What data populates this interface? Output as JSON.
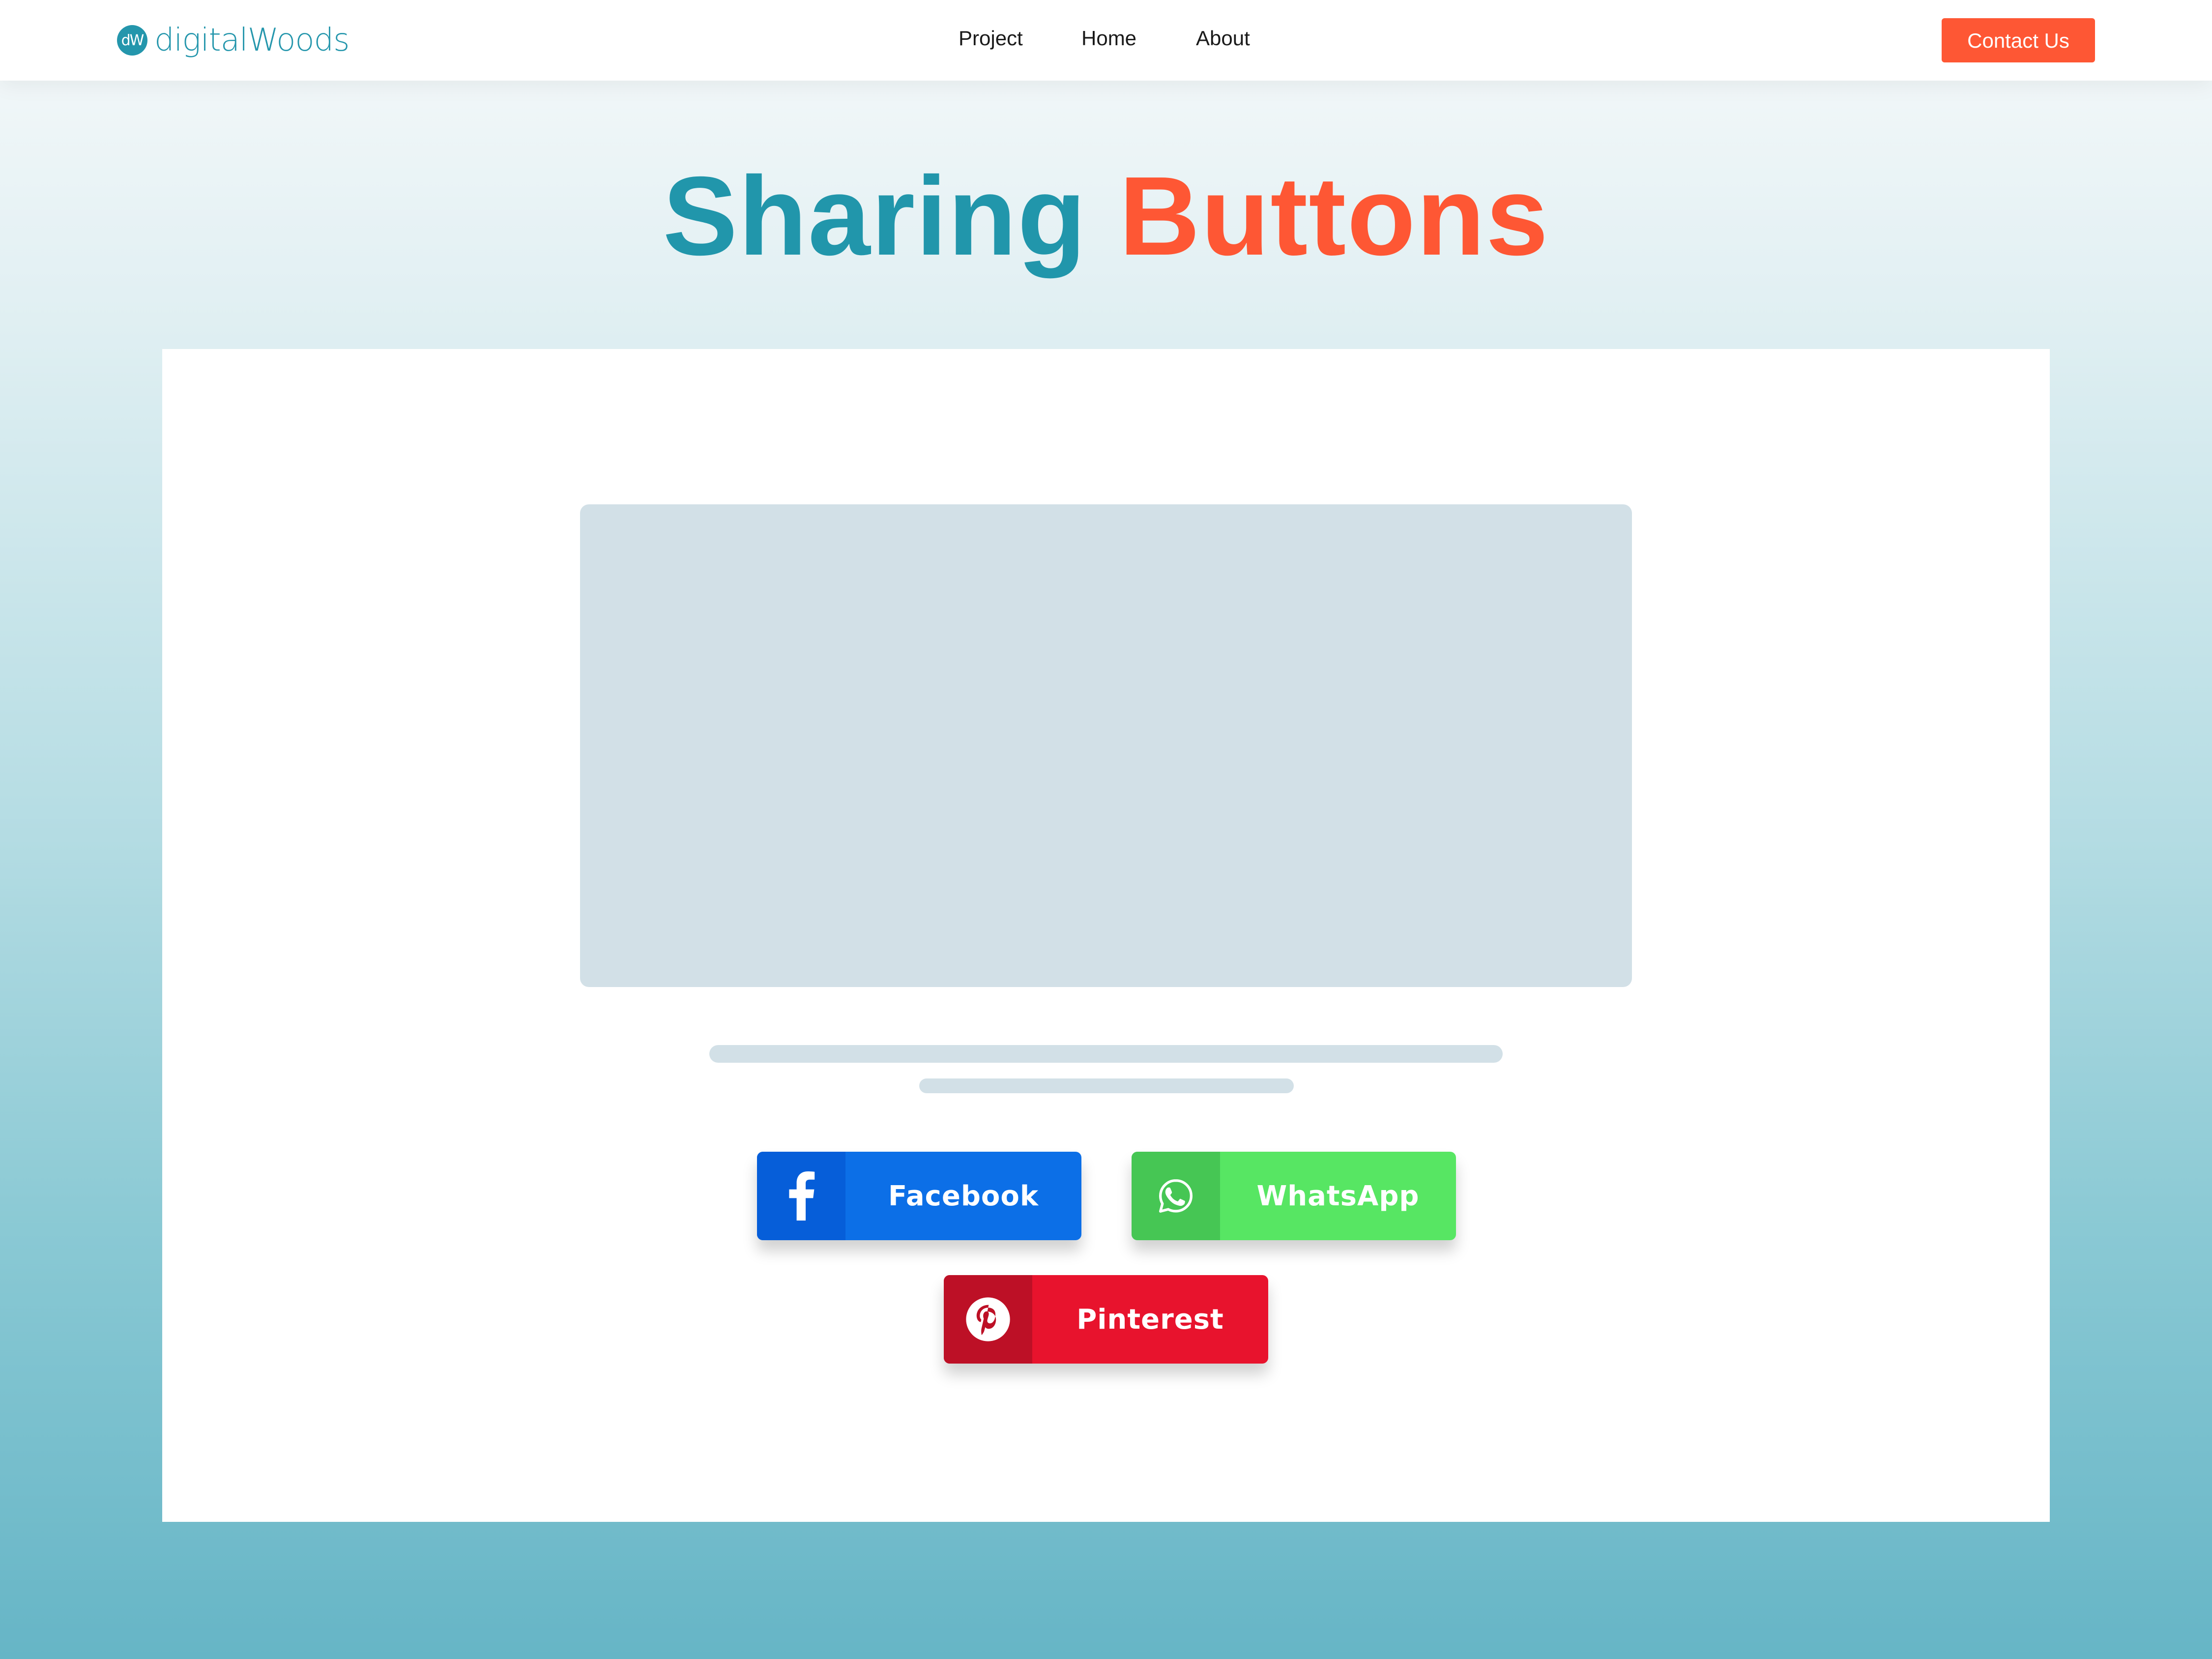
{
  "navbar": {
    "brand": {
      "icon_text": "dW",
      "name": "digitalWoods"
    },
    "links": [
      {
        "label": "Project"
      },
      {
        "label": "Home"
      },
      {
        "label": "About"
      }
    ],
    "contact_label": "Contact Us"
  },
  "hero": {
    "title_part1": "Sharing",
    "title_part2": "Buttons"
  },
  "share_buttons": [
    {
      "label": "Facebook",
      "icon": "facebook-icon",
      "color": "#0c6fe7"
    },
    {
      "label": "WhatsApp",
      "icon": "whatsapp-icon",
      "color": "#57e663"
    },
    {
      "label": "Pinterest",
      "icon": "pinterest-icon",
      "color": "#e8132d"
    }
  ],
  "colors": {
    "accent_teal": "#2196ab",
    "accent_orange": "#fe5734",
    "placeholder": "#d2e0e7"
  }
}
